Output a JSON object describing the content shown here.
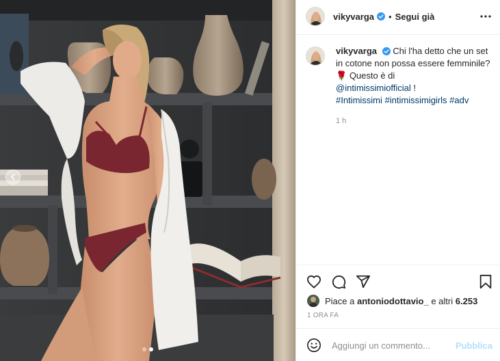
{
  "post": {
    "username": "vikyvarga",
    "separator": "•",
    "follow_label": "Segui già",
    "caption": {
      "username": "vikyvarga",
      "text_line1": "Chi l'ha detto che un set in cotone non possa essere femminile?",
      "emoji": "🌹",
      "text_line2": "Questo è di",
      "mention": "@intimissimiofficial",
      "mention_suffix": "!",
      "hashtags": [
        "#Intimissimi",
        "#intimissimigirls",
        "#adv"
      ],
      "time": "1 h"
    },
    "likes": {
      "prefix": "Piace a",
      "user": "antoniodottavio_",
      "suffix": "e altri",
      "count": "6.253"
    },
    "time_ago": "1 ORA FA"
  },
  "comment": {
    "placeholder": "Aggiungi un commento...",
    "publish_label": "Pubblica"
  },
  "carousel": {
    "total": 2,
    "active": 2
  },
  "colors": {
    "link": "#00376b",
    "verified": "#3897f0",
    "publish_disabled": "#b2dffc",
    "muted": "#8e8e8e"
  },
  "icons": [
    "more-horizontal-icon",
    "verified-badge-icon",
    "heart-icon",
    "comment-icon",
    "share-icon",
    "bookmark-icon",
    "emoji-icon",
    "chevron-left-icon"
  ]
}
